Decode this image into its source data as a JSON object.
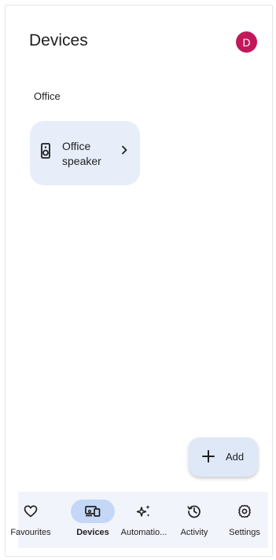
{
  "header": {
    "title": "Devices",
    "avatar_initial": "D"
  },
  "sections": [
    {
      "name": "Office",
      "devices": [
        {
          "label_line1": "Office",
          "label_line2": "speaker",
          "icon": "speaker-icon"
        }
      ]
    }
  ],
  "fab": {
    "label": "Add",
    "icon": "plus-icon"
  },
  "nav": {
    "items": [
      {
        "label": "Favourites",
        "icon": "heart-icon",
        "active": false
      },
      {
        "label": "Devices",
        "icon": "devices-icon",
        "active": true
      },
      {
        "label": "Automatio...",
        "icon": "sparkle-icon",
        "active": false
      },
      {
        "label": "Activity",
        "icon": "history-icon",
        "active": false
      },
      {
        "label": "Settings",
        "icon": "gear-icon",
        "active": false
      }
    ]
  },
  "colors": {
    "avatar": "#c2185b",
    "card": "#e7eefa",
    "nav_active": "#c4d7f6",
    "navbar": "#f2f4fb"
  }
}
